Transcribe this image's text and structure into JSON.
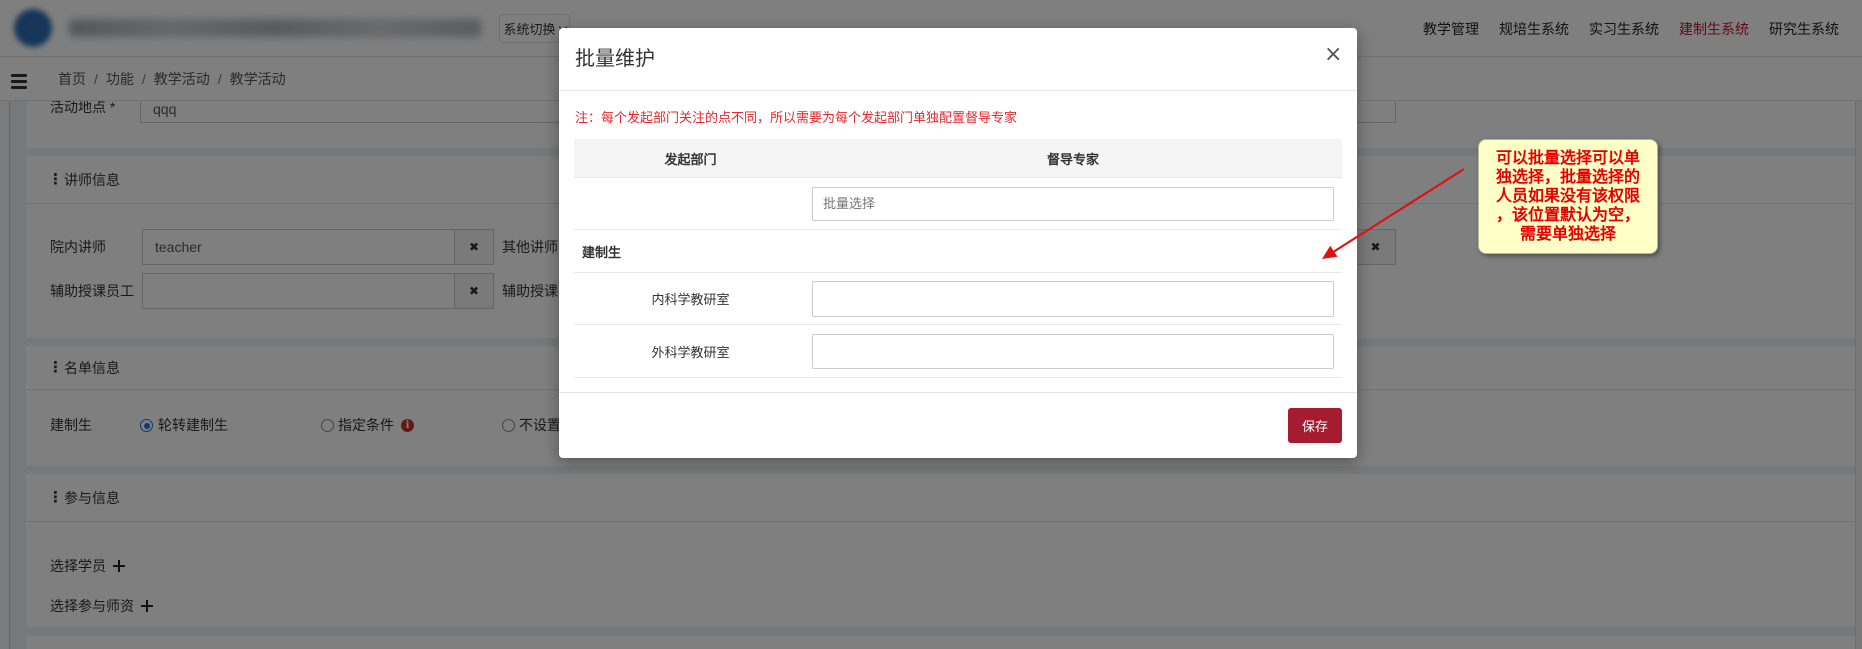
{
  "header": {
    "system_switch_label": "系统切换",
    "nav": [
      {
        "label": "教学管理",
        "active": false
      },
      {
        "label": "规培生系统",
        "active": false
      },
      {
        "label": "实习生系统",
        "active": false
      },
      {
        "label": "建制生系统",
        "active": true
      },
      {
        "label": "研究生系统",
        "active": false
      }
    ]
  },
  "breadcrumb": {
    "separator": "/",
    "items": [
      "首页",
      "功能",
      "教学活动",
      "教学活动"
    ]
  },
  "form": {
    "location": {
      "label": "活动地点 *",
      "value": "qqq"
    },
    "lecturer": {
      "title": "讲师信息",
      "internal_label": "院内讲师",
      "internal_value": "teacher",
      "other_label": "其他讲师",
      "assistant_label": "辅助授课员工",
      "other_assistant_label": "辅助授课"
    },
    "roster": {
      "title": "名单信息",
      "label": "建制生",
      "options": [
        {
          "label": "轮转建制生",
          "checked": true
        },
        {
          "label": "指定条件",
          "checked": false
        },
        {
          "label": "不设置",
          "checked": false
        }
      ]
    },
    "participation": {
      "title": "参与信息",
      "select_students": "选择学员",
      "select_teachers": "选择参与师资"
    }
  },
  "modal": {
    "title": "批量维护",
    "close_label": "×",
    "note": "注：每个发起部门关注的点不同，所以需要为每个发起部门单独配置督导专家",
    "table": {
      "headers": [
        "发起部门",
        "督导专家"
      ],
      "batch_select_placeholder": "批量选择",
      "group_label": "建制生",
      "rows": [
        {
          "department": "内科学教研室",
          "expert": ""
        },
        {
          "department": "外科学教研室",
          "expert": ""
        }
      ]
    },
    "save_label": "保存"
  },
  "annotation": {
    "lines": [
      "可以批量选择可以单",
      "独选择，批量选择的",
      "人员如果没有该权限",
      "，该位置默认为空，",
      "需要单独选择"
    ]
  },
  "icons": [
    "logo-icon",
    "chevron-down-icon",
    "hamburger-icon",
    "vertical-dots-icon",
    "clear-icon",
    "info-icon",
    "plus-icon",
    "close-icon",
    "arrow-icon"
  ],
  "colors": {
    "accent": "#a51b2f",
    "active_nav": "#c8102e",
    "note_text": "#e4282e",
    "annotation_text": "#e60000",
    "annotation_bg": "#ffffc8",
    "overlay": "rgba(0,0,0,0.5)"
  }
}
